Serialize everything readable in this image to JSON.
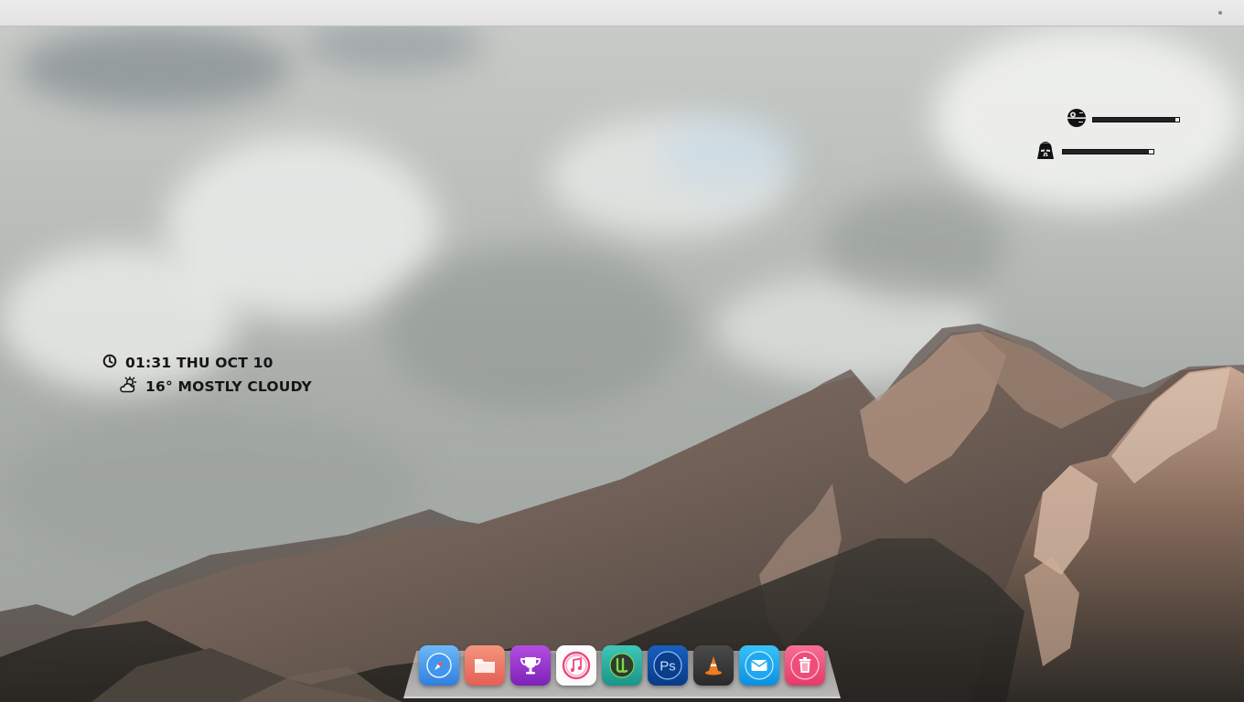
{
  "top_panel": {},
  "clock_widget": {
    "time": "01:31 THU OCT 10",
    "weather": "16° MOSTLY CLOUDY",
    "clock_icon": "clock-icon",
    "weather_icon": "partly-cloudy-icon"
  },
  "system_monitor": [
    {
      "icon": "death-star-icon",
      "level_percent": 96
    },
    {
      "icon": "darth-vader-helmet-icon",
      "level_percent": 95
    }
  ],
  "dock": {
    "items": [
      {
        "icon": "safari-compass-icon",
        "color": "#3d8ee8"
      },
      {
        "icon": "folder-icon",
        "color": "#ee6f5e"
      },
      {
        "icon": "trophy-icon",
        "color": "#9b2fd0"
      },
      {
        "icon": "itunes-music-icon",
        "color": "#ffffff"
      },
      {
        "icon": "utorrent-icon",
        "color": "#2bb3a6"
      },
      {
        "icon": "photoshop-icon",
        "color": "#0b4fa8"
      },
      {
        "icon": "vlc-cone-icon",
        "color": "#3a3a3a"
      },
      {
        "icon": "mail-icon",
        "color": "#1aa6f0"
      },
      {
        "icon": "trash-icon",
        "color": "#f0507a"
      }
    ]
  }
}
